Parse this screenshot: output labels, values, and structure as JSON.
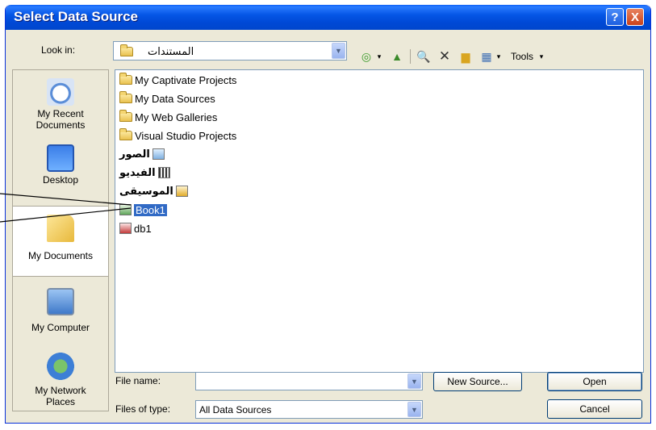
{
  "window": {
    "title": "Select Data Source",
    "help_glyph": "?",
    "close_glyph": "X"
  },
  "lookin": {
    "label": "Look in:",
    "value": "المستندات",
    "arrow": "▼"
  },
  "toolbar": {
    "back_glyph": "◎",
    "up_glyph": "▲",
    "search_glyph": "🔍",
    "delete_glyph": "✕",
    "newfolder_glyph": "▆",
    "views_glyph": "▦",
    "dropdown_glyph": "▾",
    "tools_label": "Tools"
  },
  "places": [
    {
      "label_1": "My Recent",
      "label_2": "Documents",
      "icon": "recent-documents-icon"
    },
    {
      "label_1": "Desktop",
      "label_2": "",
      "icon": "desktop-icon"
    },
    {
      "label_1": "My Documents",
      "label_2": "",
      "icon": "my-documents-icon"
    },
    {
      "label_1": "My Computer",
      "label_2": "",
      "icon": "my-computer-icon"
    },
    {
      "label_1": "My Network",
      "label_2": "Places",
      "icon": "network-places-icon"
    }
  ],
  "files": [
    {
      "name": "My Captivate Projects",
      "icon": "folder"
    },
    {
      "name": "My Data Sources",
      "icon": "folder"
    },
    {
      "name": "My Web Galleries",
      "icon": "folder"
    },
    {
      "name": "Visual Studio Projects",
      "icon": "folder"
    },
    {
      "name": "الصور",
      "icon": "pictures"
    },
    {
      "name": "الفيديو",
      "icon": "video"
    },
    {
      "name": "الموسيقى",
      "icon": "music"
    },
    {
      "name": "Book1",
      "icon": "excel",
      "selected": true
    },
    {
      "name": "db1",
      "icon": "access"
    }
  ],
  "form": {
    "filename_label": "File name:",
    "filename_value": "",
    "filetype_label": "Files of type:",
    "filetype_value": "All Data Sources",
    "new_source_label": "New Source...",
    "open_label": "Open",
    "cancel_label": "Cancel",
    "arrow": "▼"
  },
  "colors": {
    "titlebar": "#0054e3",
    "selection": "#316ac5",
    "dialog_bg": "#ece9d8"
  }
}
